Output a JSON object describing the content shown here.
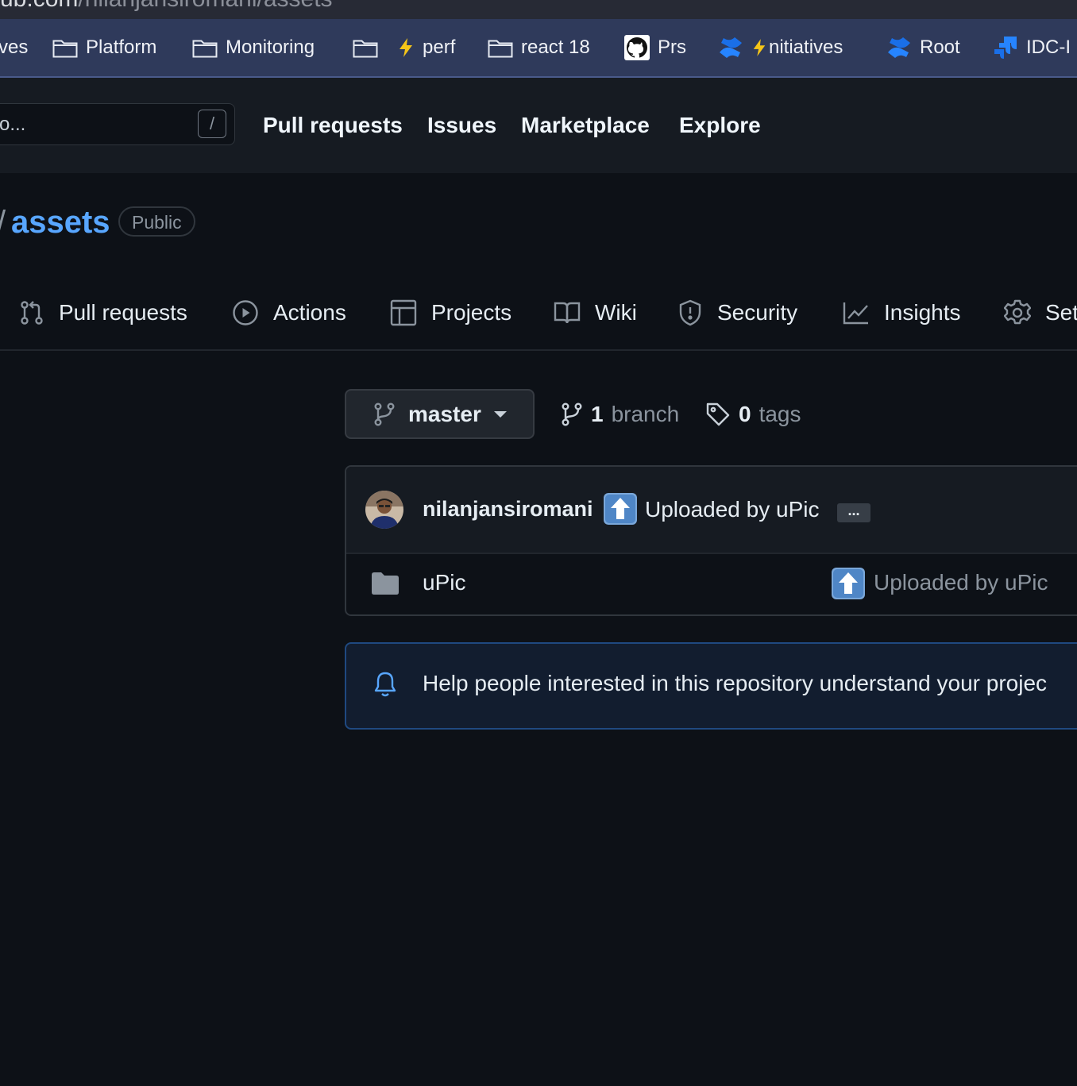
{
  "browser": {
    "url_host": "ub.com",
    "url_path": "/nilanjansiromani/assets",
    "bookmarks": [
      {
        "label": "ves",
        "icon": "none"
      },
      {
        "label": "Platform",
        "icon": "folder-icon"
      },
      {
        "label": "Monitoring",
        "icon": "folder-icon"
      },
      {
        "label": "",
        "icon": "folder-icon"
      },
      {
        "label": "perf",
        "icon": "lightning-icon"
      },
      {
        "label": "react 18",
        "icon": "folder-icon"
      },
      {
        "label": "Prs",
        "icon": "github-icon"
      },
      {
        "label": "nitiatives",
        "icon": "confluence-lightning-icon"
      },
      {
        "label": "Root",
        "icon": "confluence-icon"
      },
      {
        "label": "IDC-I",
        "icon": "jira-icon"
      }
    ]
  },
  "header": {
    "search_placeholder": "o...",
    "search_shortcut": "/",
    "nav": [
      "Pull requests",
      "Issues",
      "Marketplace",
      "Explore"
    ]
  },
  "repo": {
    "slash": "/",
    "name": "assets",
    "visibility": "Public",
    "tabs": [
      {
        "label": "Pull requests",
        "icon": "git-pull-request-icon"
      },
      {
        "label": "Actions",
        "icon": "play-icon"
      },
      {
        "label": "Projects",
        "icon": "table-icon"
      },
      {
        "label": "Wiki",
        "icon": "book-icon"
      },
      {
        "label": "Security",
        "icon": "shield-icon"
      },
      {
        "label": "Insights",
        "icon": "graph-icon"
      },
      {
        "label": "Set",
        "icon": "gear-icon"
      }
    ]
  },
  "branch": {
    "current": "master",
    "branch_count": "1",
    "branch_label": "branch",
    "tag_count": "0",
    "tag_label": "tags"
  },
  "commit": {
    "author": "nilanjansiromani",
    "message": "Uploaded by uPic",
    "more": "..."
  },
  "files": [
    {
      "name": "uPic",
      "type": "folder",
      "message": "Uploaded by uPic"
    }
  ],
  "readme_callout": {
    "text": "Help people interested in this repository understand your projec"
  },
  "colors": {
    "background": "#0d1117",
    "header": "#161b22",
    "link": "#58a6ff",
    "bookmarks_bar": "#2f3a5b"
  }
}
